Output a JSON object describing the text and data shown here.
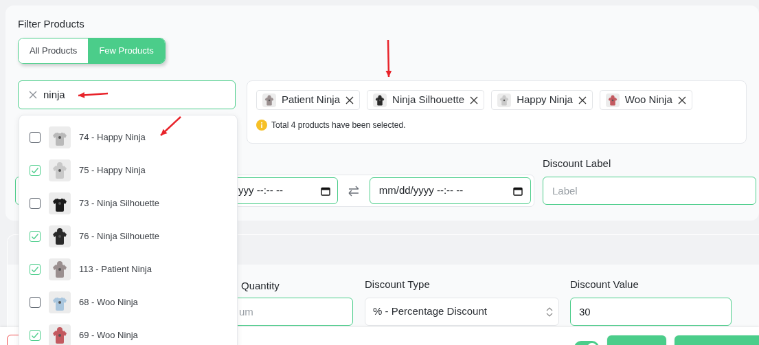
{
  "filter": {
    "title": "Filter Products",
    "segments": [
      {
        "label": "All Products",
        "selected": false
      },
      {
        "label": "Few Products",
        "selected": true
      }
    ]
  },
  "search": {
    "value": "ninja"
  },
  "selected_products": {
    "chips": [
      {
        "label": "Patient Ninja"
      },
      {
        "label": "Ninja Silhouette"
      },
      {
        "label": "Happy Ninja"
      },
      {
        "label": "Woo Ninja"
      }
    ],
    "note": "Total 4 products have been selected."
  },
  "schedule": {
    "start_value": "yyy --:-- --",
    "end_value": "mm/dd/yyyy --:-- --"
  },
  "discount_label": {
    "label": "Discount Label",
    "placeholder": "Label"
  },
  "quantity": {
    "label": "Quantity",
    "placeholder": "um"
  },
  "discount_type": {
    "label": "Discount Type",
    "value": "% - Percentage Discount"
  },
  "discount_value": {
    "label": "Discount Value",
    "value": "30"
  },
  "bottom_bar": {
    "toggle": {
      "on": true
    }
  },
  "dropdown": {
    "items": [
      {
        "label": "74 - Happy Ninja",
        "checked": false
      },
      {
        "label": "75 - Happy Ninja",
        "checked": true
      },
      {
        "label": "73 - Ninja Silhouette",
        "checked": false
      },
      {
        "label": "76 - Ninja Silhouette",
        "checked": true
      },
      {
        "label": "113 - Patient Ninja",
        "checked": true
      },
      {
        "label": "68 - Woo Ninja",
        "checked": false
      },
      {
        "label": "69 - Woo Ninja",
        "checked": true
      }
    ]
  }
}
